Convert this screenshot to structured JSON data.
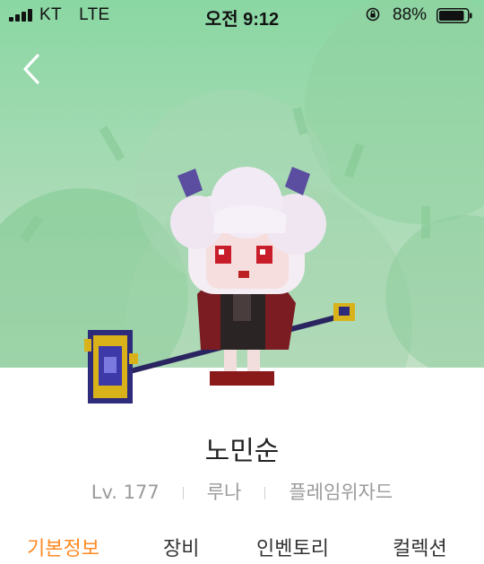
{
  "status_bar": {
    "carrier": "KT",
    "network": "LTE",
    "time": "오전 9:12",
    "battery": "88%"
  },
  "character": {
    "name": "노민순",
    "level": "Lv. 177",
    "world": "루나",
    "job": "플레임위자드"
  },
  "tabs": [
    {
      "label": "기본정보",
      "active": true
    },
    {
      "label": "장비",
      "active": false
    },
    {
      "label": "인벤토리",
      "active": false
    },
    {
      "label": "컬렉션",
      "active": false
    }
  ],
  "colors": {
    "accent": "#ff8a23",
    "hero_bg": "#a2dab1"
  },
  "icons": {
    "back": "chevron-left-icon",
    "rotation_lock": "rotation-lock-icon",
    "battery": "battery-icon",
    "signal": "signal-bars-icon"
  }
}
